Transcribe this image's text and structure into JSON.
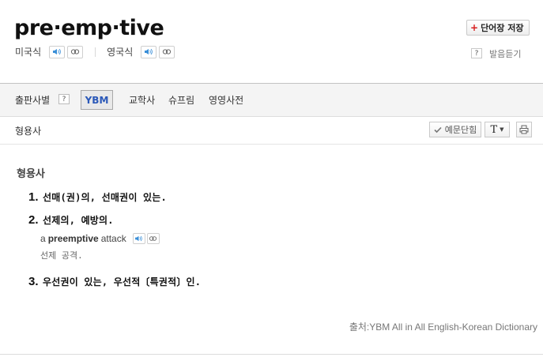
{
  "header": {
    "word": "pre·emp·tive",
    "save_button": "단어장 저장",
    "pron_us_label": "미국식",
    "pron_uk_label": "영국식",
    "help": "?",
    "pron_listen": "발음듣기"
  },
  "source_tabs": {
    "items": [
      "출판사별",
      "YBM",
      "교학사",
      "슈프림",
      "영영사전"
    ],
    "help": "?",
    "selected": "YBM"
  },
  "toolbar": {
    "pos": "형용사",
    "example_toggle": "예문단힘",
    "font_button": "T"
  },
  "entry": {
    "pos_heading": "형용사",
    "senses": [
      {
        "num": "1.",
        "def": "선매(권)의, 선매권이 있는."
      },
      {
        "num": "2.",
        "def": "선제의, 예방의."
      },
      {
        "num": "3.",
        "def": "우선권이 있는, 우선적〔특권적〕인."
      }
    ],
    "example": {
      "pre": "a",
      "bold": "preemptive",
      "post": "attack",
      "translation": "선제 공격."
    },
    "source": "출처:YBM All in All English-Korean Dictionary"
  },
  "colors": {
    "accent_blue": "#2a58b8",
    "save_plus_red": "#d81e1e",
    "speaker_blue": "#3a8fd8"
  },
  "icons": [
    "plus-icon",
    "speaker-icon",
    "repeat-icon",
    "check-icon",
    "caret-down-icon",
    "printer-icon"
  ]
}
